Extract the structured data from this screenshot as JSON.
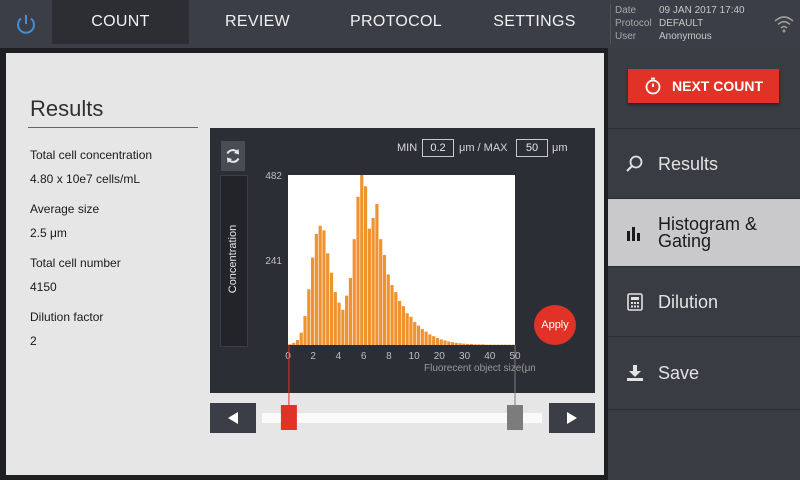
{
  "tabs": [
    {
      "label": "COUNT",
      "active": true
    },
    {
      "label": "REVIEW",
      "active": false
    },
    {
      "label": "PROTOCOL",
      "active": false
    },
    {
      "label": "SETTINGS",
      "active": false
    }
  ],
  "info": {
    "date_label": "Date",
    "date_value": "09 JAN 2017 17:40",
    "protocol_label": "Protocol",
    "protocol_value": "DEFAULT",
    "user_label": "User",
    "user_value": "Anonymous"
  },
  "results": {
    "title": "Results",
    "total_conc_label": "Total cell concentration",
    "total_conc_value": "4.80 x 10e7 cells/mL",
    "avg_size_label": "Average size",
    "avg_size_value": "2.5  μm",
    "total_num_label": "Total cell number",
    "total_num_value": "4150",
    "dilution_label": "Dilution factor",
    "dilution_value": "2"
  },
  "gating": {
    "min_label": "MIN",
    "min_value": "0.2",
    "max_label": "μm / MAX",
    "max_value": "50",
    "unit": "μm",
    "apply_label": "Apply",
    "range_start": 0.2,
    "range_end": 50
  },
  "chart_data": {
    "type": "bar",
    "xlabel": "Fluorecent object size(μm)",
    "ylabel": "Concentration",
    "xlim": [
      0,
      50
    ],
    "ylim": [
      0,
      482
    ],
    "xticks": [
      "0",
      "2",
      "4",
      "6",
      "8",
      "10",
      "20",
      "30",
      "40",
      "50"
    ],
    "yticks": [
      "241",
      "482"
    ],
    "bar_color": "#f0922e",
    "values": [
      2,
      6,
      14,
      35,
      82,
      158,
      248,
      315,
      338,
      325,
      260,
      205,
      150,
      120,
      100,
      140,
      190,
      300,
      420,
      482,
      450,
      330,
      360,
      400,
      300,
      255,
      200,
      170,
      150,
      125,
      110,
      90,
      80,
      65,
      55,
      45,
      38,
      30,
      25,
      20,
      16,
      13,
      10,
      8,
      6,
      5,
      4,
      3,
      3,
      2,
      2,
      2,
      1,
      1,
      1,
      1,
      1,
      1,
      1,
      1
    ]
  },
  "sidebar": {
    "next_count_label": "NEXT COUNT",
    "items": [
      {
        "label": "Results",
        "icon": "search-icon",
        "active": false
      },
      {
        "label": "Histogram &\nGating",
        "icon": "histogram-icon",
        "active": true
      },
      {
        "label": "Dilution",
        "icon": "calculator-icon",
        "active": false
      },
      {
        "label": "Save",
        "icon": "download-icon",
        "active": false
      }
    ]
  },
  "colors": {
    "accent": "#e03226",
    "bar": "#f0922e",
    "min_handle": "#e03226",
    "max_handle": "#7c7c7c"
  }
}
